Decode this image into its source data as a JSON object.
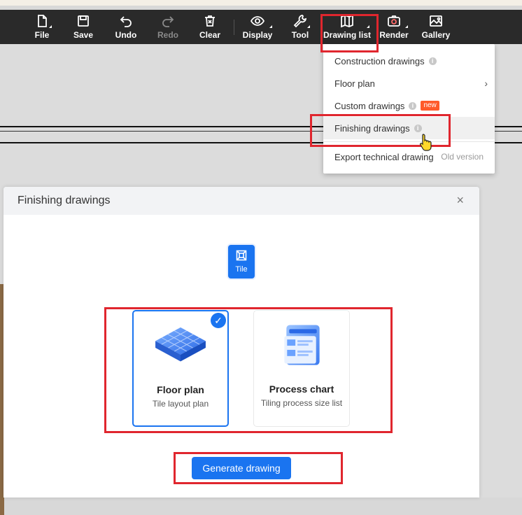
{
  "toolbar": {
    "items": [
      {
        "label": "File",
        "icon": "file-icon"
      },
      {
        "label": "Save",
        "icon": "save-icon"
      },
      {
        "label": "Undo",
        "icon": "undo-icon"
      },
      {
        "label": "Redo",
        "icon": "redo-icon",
        "disabled": true
      },
      {
        "label": "Clear",
        "icon": "trash-icon"
      },
      {
        "label": "Display",
        "icon": "eye-icon"
      },
      {
        "label": "Tool",
        "icon": "wrench-icon"
      },
      {
        "label": "Drawing list",
        "icon": "map-icon"
      },
      {
        "label": "Render",
        "icon": "camera-icon"
      },
      {
        "label": "Gallery",
        "icon": "image-icon"
      }
    ]
  },
  "menu": {
    "items": [
      {
        "label": "Construction drawings",
        "info": "i"
      },
      {
        "label": "Floor plan",
        "chevron": "›"
      },
      {
        "label": "Custom drawings",
        "info": "i",
        "badge": "new"
      },
      {
        "label": "Finishing drawings",
        "info": "i"
      },
      {
        "label": "Export technical drawing",
        "note": "Old version"
      }
    ]
  },
  "dialog": {
    "title": "Finishing drawings",
    "close": "×",
    "tab": {
      "label": "Tile"
    },
    "cards": [
      {
        "title": "Floor plan",
        "subtitle": "Tile layout plan",
        "selected": true,
        "check": "✓"
      },
      {
        "title": "Process chart",
        "subtitle": "Tiling process size list",
        "selected": false
      }
    ],
    "generate_label": "Generate drawing"
  },
  "colors": {
    "accent": "#1a74f0",
    "toolbar_bg": "#2a2a2a",
    "highlight": "#e0262e",
    "badge": "#ff5a2a"
  }
}
